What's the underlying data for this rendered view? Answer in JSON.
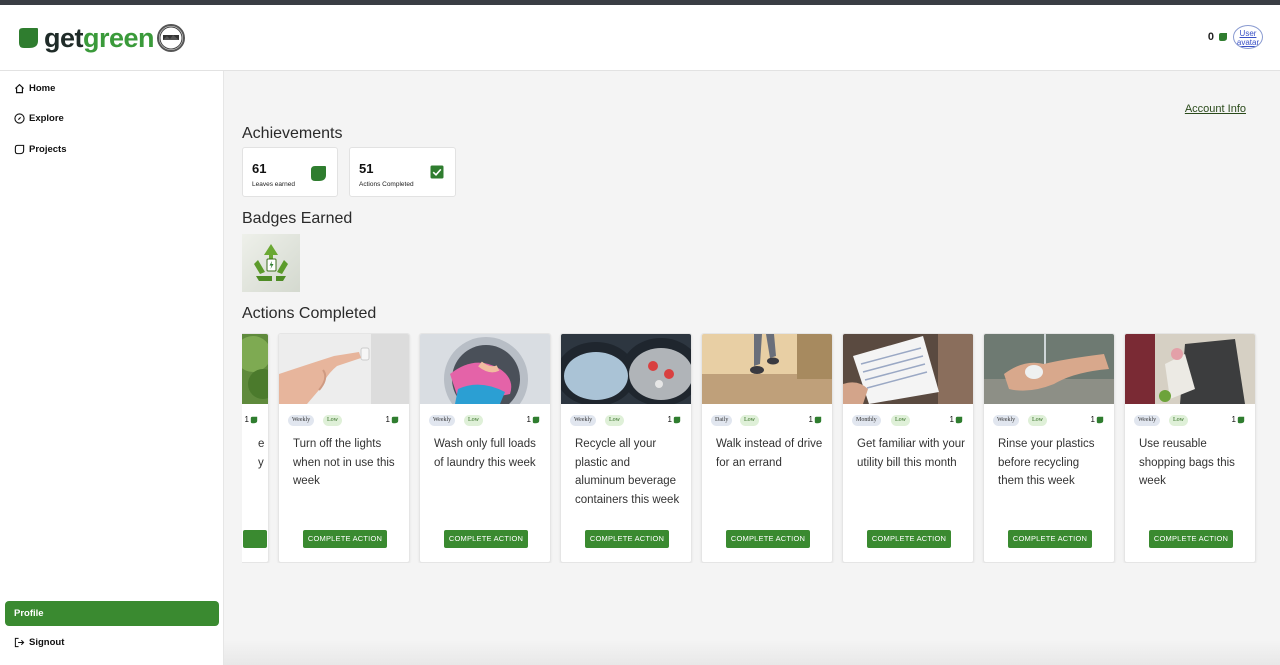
{
  "header": {
    "logo_get": "get",
    "logo_green": "green",
    "leaf_count": "0",
    "avatar_alt": "User avatar"
  },
  "sidebar": {
    "items": [
      {
        "label": "Home",
        "icon": "home-icon"
      },
      {
        "label": "Explore",
        "icon": "compass-icon"
      },
      {
        "label": "Projects",
        "icon": "leaf-outline-icon"
      }
    ],
    "profile_label": "Profile",
    "signout_label": "Signout"
  },
  "main": {
    "account_link": "Account Info",
    "achievements_title": "Achievements",
    "stats": [
      {
        "value": "61",
        "label": "Leaves earned",
        "icon": "leaf-icon"
      },
      {
        "value": "51",
        "label": "Actions Completed",
        "icon": "checkbox-icon"
      }
    ],
    "badges_title": "Badges Earned",
    "actions_title": "Actions Completed",
    "cards": [
      {
        "frequency": "",
        "impact": "",
        "leaves": "1",
        "title": "e\ny",
        "button": ""
      },
      {
        "frequency": "Weekly",
        "impact": "Low",
        "leaves": "1",
        "title": "Turn off the lights when not in use this week",
        "button": "COMPLETE ACTION"
      },
      {
        "frequency": "Weekly",
        "impact": "Low",
        "leaves": "1",
        "title": "Wash only full loads of laundry this week",
        "button": "COMPLETE ACTION"
      },
      {
        "frequency": "Weekly",
        "impact": "Low",
        "leaves": "1",
        "title": "Recycle all your plastic and aluminum beverage containers this week",
        "button": "COMPLETE ACTION"
      },
      {
        "frequency": "Daily",
        "impact": "Low",
        "leaves": "1",
        "title": "Walk instead of drive for an errand",
        "button": "COMPLETE ACTION"
      },
      {
        "frequency": "Monthly",
        "impact": "Low",
        "leaves": "1",
        "title": "Get familiar with your utility bill this month",
        "button": "COMPLETE ACTION"
      },
      {
        "frequency": "Weekly",
        "impact": "Low",
        "leaves": "1",
        "title": "Rinse your plastics before recycling them this week",
        "button": "COMPLETE ACTION"
      },
      {
        "frequency": "Weekly",
        "impact": "Low",
        "leaves": "1",
        "title": "Use reusable shopping bags this week",
        "button": "COMPLETE ACTION"
      }
    ]
  },
  "colors": {
    "brand_green": "#3a8a30",
    "logo_dark": "#1f2b28",
    "logo_green": "#3a9a3a",
    "low_tag_bg": "#dff0d8",
    "freq_tag_bg": "#e1e6ef"
  }
}
